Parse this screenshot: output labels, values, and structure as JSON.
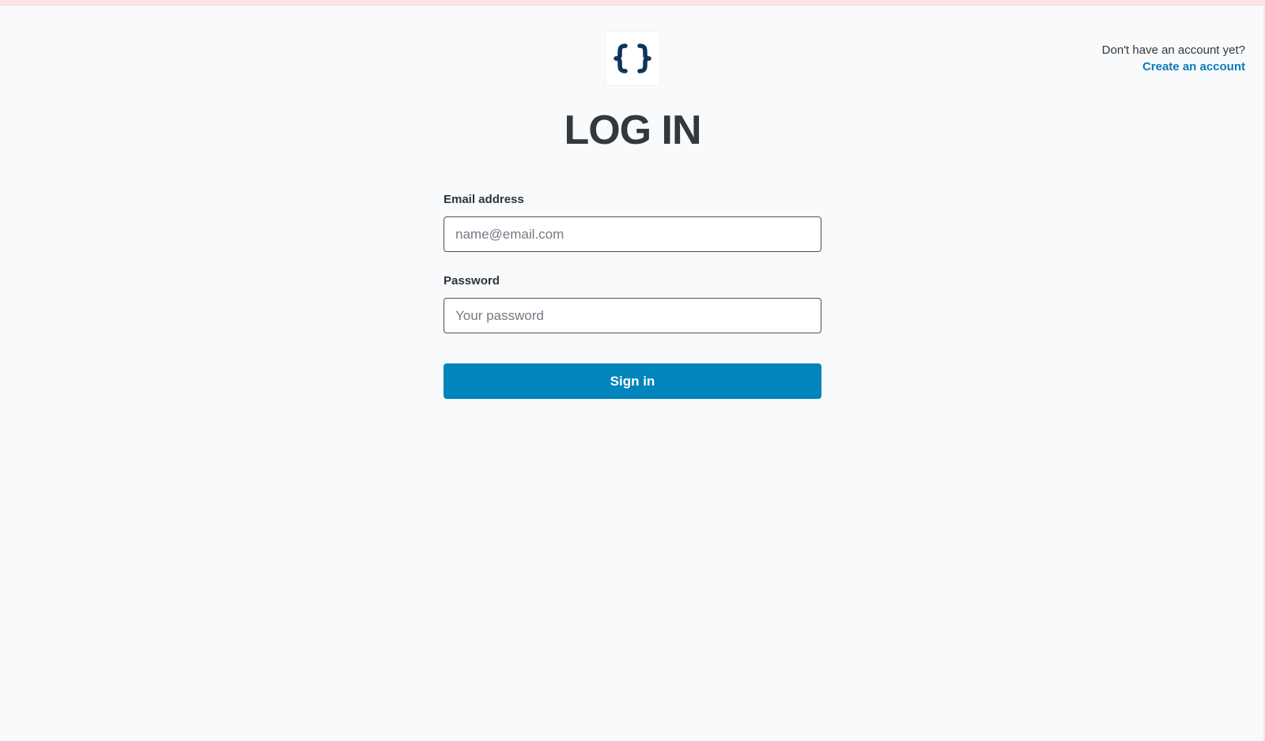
{
  "header": {
    "signup_question": "Don't have an account yet?",
    "signup_link": "Create an account"
  },
  "logo": {
    "icon": "curly-braces-icon",
    "color": "#0c3559"
  },
  "page": {
    "title": "LOG IN"
  },
  "form": {
    "email_label": "Email address",
    "email_placeholder": "name@email.com",
    "email_value": "",
    "password_label": "Password",
    "password_placeholder": "Your password",
    "password_value": "",
    "submit_label": "Sign in"
  },
  "colors": {
    "accent": "#0284bd",
    "link": "#0a7cb5",
    "text": "#34383e",
    "background": "#f9fafb"
  }
}
